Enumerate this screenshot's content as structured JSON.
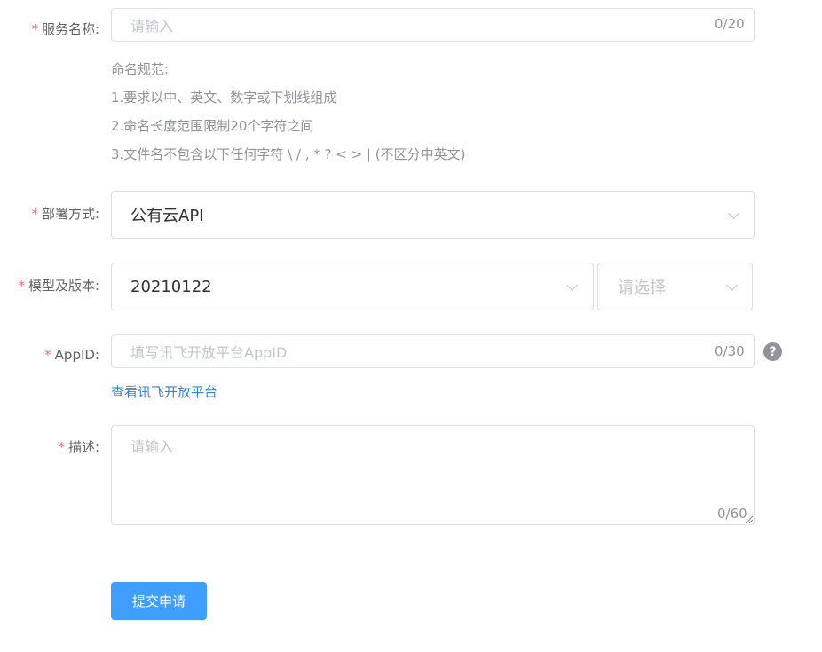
{
  "form": {
    "service_name": {
      "label": "服务名称:",
      "placeholder": "请输入",
      "counter": "0/20"
    },
    "naming_rules": {
      "title": "命名规范:",
      "rule1": "1.要求以中、英文、数字或下划线组成",
      "rule2": "2.命名长度范围限制20个字符之间",
      "rule3": "3.文件名不包含以下任何字符 \\ / , * ? < > | (不区分中英文)"
    },
    "deploy_method": {
      "label": "部署方式:",
      "value": "公有云API"
    },
    "model_version": {
      "label": "模型及版本:",
      "model_value": "20210122",
      "version_placeholder": "请选择"
    },
    "appid": {
      "label": "AppID:",
      "placeholder": "填写讯飞开放平台AppID",
      "counter": "0/30",
      "help": "?",
      "link": "查看讯飞开放平台"
    },
    "description": {
      "label": "描述:",
      "placeholder": "请输入",
      "counter": "0/60"
    },
    "submit_label": "提交申请"
  },
  "icons": {
    "chevron": "chevron-down-icon",
    "help": "question-circle-icon"
  },
  "colors": {
    "required": "#f56c6c",
    "primary": "#409eff",
    "link": "#2b85e4",
    "border": "#dcdfe6",
    "placeholder": "#c0c4cc"
  }
}
